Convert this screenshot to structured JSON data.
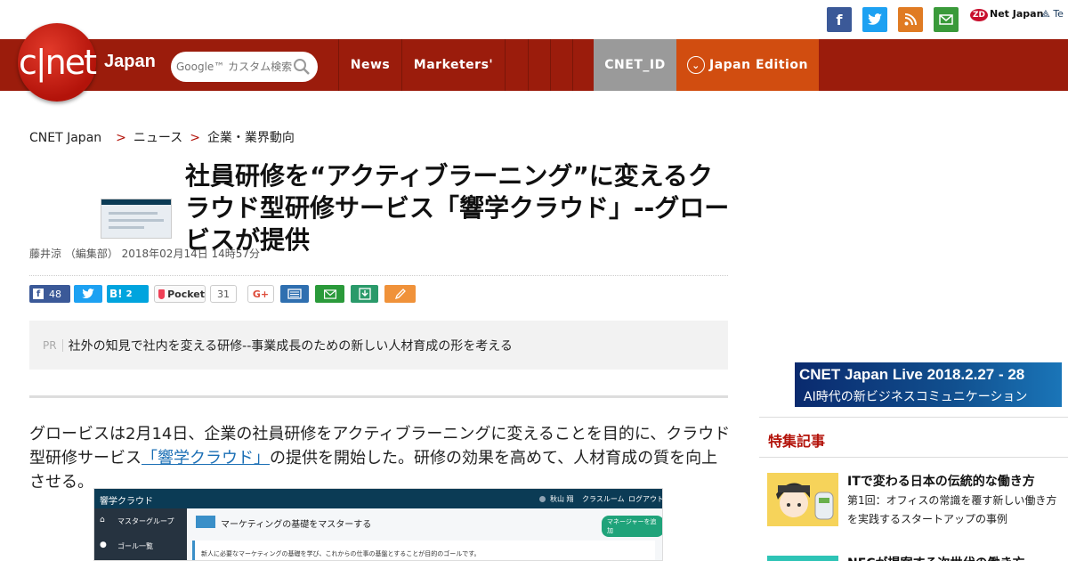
{
  "social": {
    "icons": [
      "facebook-icon",
      "twitter-icon",
      "rss-icon",
      "mail-icon"
    ],
    "zdnet": "Net Japan",
    "zdnet_badge": "ZD",
    "techrepublic": "Te"
  },
  "nav": {
    "logo_text": "c|net",
    "logo_japan": "Japan",
    "search_placeholder": "Google™ カスタム検索",
    "items": [
      "News",
      "Marketers'"
    ],
    "cnet_id": "CNET_ID",
    "edition": "Japan Edition"
  },
  "breadcrumb": {
    "home": "CNET Japan",
    "sep": ">",
    "level1": "ニュース",
    "level2": "企業・業界動向"
  },
  "article": {
    "title": "社員研修を“アクティブラーニング”に変えるクラウド型研修サービス「響学クラウド」--グロービスが提供",
    "byline": "藤井涼 （編集部） 2018年02月14日 14時57分",
    "share": {
      "facebook_count": "48",
      "hatena": "B!",
      "hatena_count": "2",
      "pocket": "Pocket",
      "pocket_count": "31",
      "gplus": "G+"
    },
    "pr_label": "PR",
    "pr_text": "社外の知見で社内を変える研修--事業成長のための新しい人材育成の形を考える",
    "body_prefix": "グロービスは2月14日、企業の社員研修をアクティブラーニングに変えることを目的に、クラウド型研修サービス",
    "body_link": "「響学クラウド」",
    "body_suffix": "の提供を開始した。研修の効果を高めて、人材育成の質を向上させる。",
    "image": {
      "app_name": "響学クラウド",
      "top_right": [
        "秋山 翔",
        "クラスルーム",
        "ログアウト"
      ],
      "side_items": [
        "マスターグループ",
        "ゴール一覧"
      ],
      "main_title": "マーケティングの基礎をマスターする",
      "add_button": "マネージャーを追加",
      "desc": "新人に必要なマーケティングの基礎を学び、これからの仕事の基盤とすることが目的のゴールです。"
    }
  },
  "sidebar": {
    "banner_line1": "CNET Japan Live 2018.2.27 - 28",
    "banner_line2": "AI時代の新ビジネスコミュニケーション",
    "heading": "特集記事",
    "item1_title": "ITで変わる日本の伝統的な働き方",
    "item1_desc": "第1回：オフィスの常識を覆す新しい働き方を実践するスタートアップの事例",
    "item2_title": "NECが提案する次世代の働き方"
  }
}
